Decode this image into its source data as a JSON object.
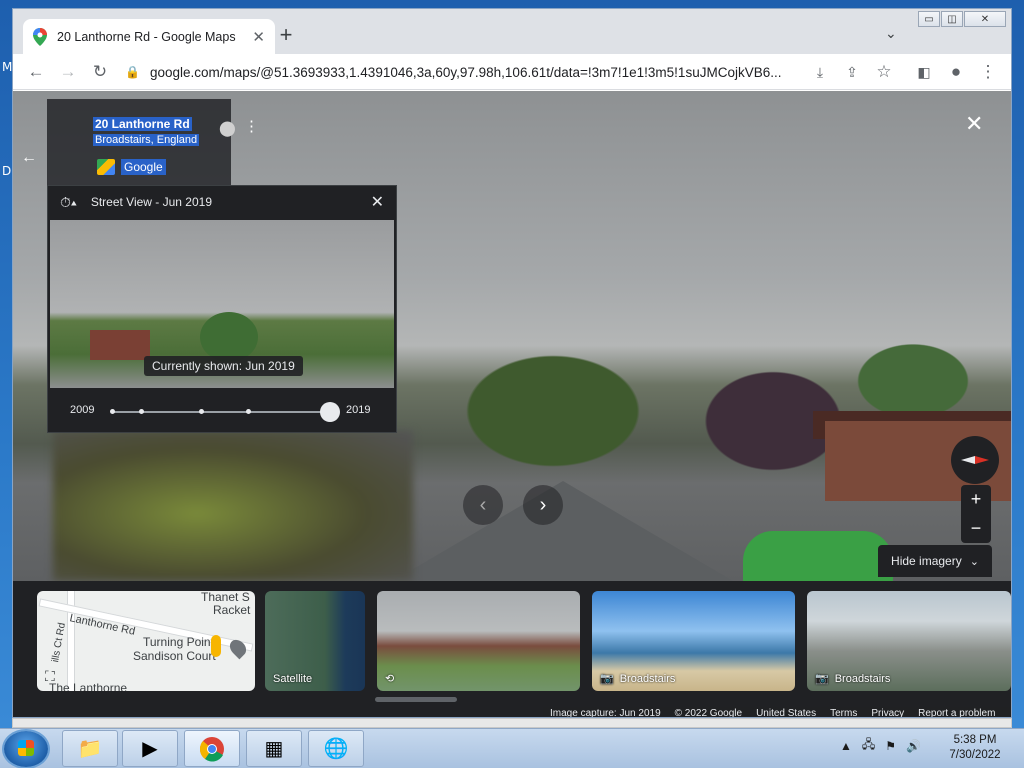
{
  "browser": {
    "tab_title": "20 Lanthorne Rd - Google Maps",
    "url": "google.com/maps/@51.3693933,1.4391046,3a,60y,97.98h,106.61t/data=!3m7!1e1!3m5!1suJMCojkVB6..."
  },
  "place": {
    "title": "20 Lanthorne Rd",
    "subtitle": "Broadstairs, England",
    "source": "Google"
  },
  "time_panel": {
    "title": "Street View - Jun 2019",
    "tooltip": "Currently shown: Jun 2019",
    "start_year": "2009",
    "end_year": "2019",
    "selected_index": 4,
    "tick_count": 5
  },
  "controls": {
    "hide_imagery": "Hide imagery"
  },
  "thumbnails": {
    "map_labels": [
      "Thanet S",
      "Racket",
      "Lanthorne Rd",
      "Turning Point",
      "Sandison Court",
      "The Lanthorne",
      "ills Ct Rd"
    ],
    "satellite": "Satellite",
    "beach": "Broadstairs",
    "cliff": "Broadstairs"
  },
  "footer": {
    "capture": "Image capture: Jun 2019",
    "copyright": "© 2022 Google",
    "region": "United States",
    "terms": "Terms",
    "privacy": "Privacy",
    "report": "Report a problem"
  },
  "taskbar": {
    "time": "5:38 PM",
    "date": "7/30/2022"
  },
  "desktop_letters": [
    "M",
    "D"
  ],
  "colors": {
    "accent_selection": "#2962c8",
    "panel_dark": "#202124"
  }
}
